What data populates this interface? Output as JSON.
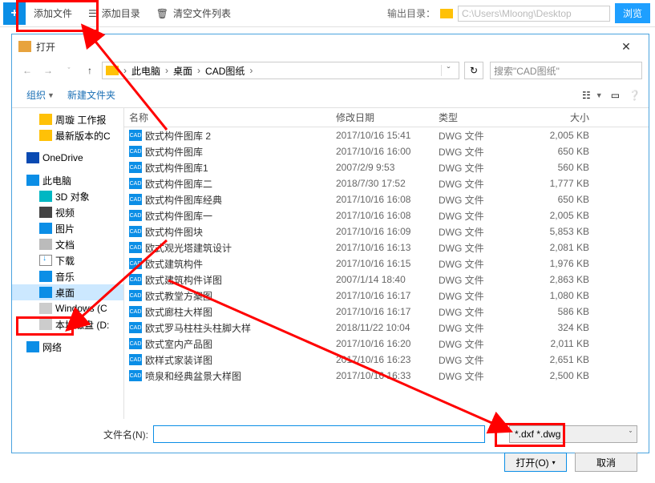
{
  "toolbar": {
    "add_file": "添加文件",
    "add_dir": "添加目录",
    "clear_list": "清空文件列表",
    "output_label": "输出目录：",
    "output_path": "C:\\Users\\Mloong\\Desktop",
    "browse": "浏览"
  },
  "dialog": {
    "title": "打开",
    "breadcrumbs": [
      "此电脑",
      "桌面",
      "CAD图纸"
    ],
    "search_placeholder": "搜索\"CAD图纸\"",
    "organize": "组织",
    "new_folder": "新建文件夹",
    "columns": {
      "name": "名称",
      "date": "修改日期",
      "type": "类型",
      "size": "大小"
    },
    "filename_label": "文件名(N):",
    "filter": "*.dxf *.dwg",
    "open_btn": "打开(O)",
    "cancel_btn": "取消"
  },
  "tree": [
    {
      "label": "周璇 工作报",
      "icon": "ico-folder",
      "sub": true
    },
    {
      "label": "最新版本的C",
      "icon": "ico-folder",
      "sub": true
    },
    {
      "sep": true
    },
    {
      "label": "OneDrive",
      "icon": "ico-onedrive"
    },
    {
      "sep": true
    },
    {
      "label": "此电脑",
      "icon": "ico-pc"
    },
    {
      "label": "3D 对象",
      "icon": "ico-3d",
      "sub": true
    },
    {
      "label": "视频",
      "icon": "ico-video",
      "sub": true
    },
    {
      "label": "图片",
      "icon": "ico-pic",
      "sub": true
    },
    {
      "label": "文档",
      "icon": "ico-doc",
      "sub": true
    },
    {
      "label": "下载",
      "icon": "ico-dl",
      "sub": true
    },
    {
      "label": "音乐",
      "icon": "ico-music",
      "sub": true
    },
    {
      "label": "桌面",
      "icon": "ico-desktop",
      "sub": true,
      "selected": true
    },
    {
      "label": "Windows (C",
      "icon": "ico-disk",
      "sub": true
    },
    {
      "label": "本地磁盘 (D:",
      "icon": "ico-disk",
      "sub": true
    },
    {
      "sep": true
    },
    {
      "label": "网络",
      "icon": "ico-net"
    }
  ],
  "files": [
    {
      "name": "欧式构件图库 2",
      "date": "2017/10/16 15:41",
      "type": "DWG 文件",
      "size": "2,005 KB"
    },
    {
      "name": "欧式构件图库",
      "date": "2017/10/16 16:00",
      "type": "DWG 文件",
      "size": "650 KB"
    },
    {
      "name": "欧式构件图库1",
      "date": "2007/2/9 9:53",
      "type": "DWG 文件",
      "size": "560 KB"
    },
    {
      "name": "欧式构件图库二",
      "date": "2018/7/30 17:52",
      "type": "DWG 文件",
      "size": "1,777 KB"
    },
    {
      "name": "欧式构件图库经典",
      "date": "2017/10/16 16:08",
      "type": "DWG 文件",
      "size": "650 KB"
    },
    {
      "name": "欧式构件图库一",
      "date": "2017/10/16 16:08",
      "type": "DWG 文件",
      "size": "2,005 KB"
    },
    {
      "name": "欧式构件图块",
      "date": "2017/10/16 16:09",
      "type": "DWG 文件",
      "size": "5,853 KB"
    },
    {
      "name": "欧式观光塔建筑设计",
      "date": "2017/10/16 16:13",
      "type": "DWG 文件",
      "size": "2,081 KB"
    },
    {
      "name": "欧式建筑构件",
      "date": "2017/10/16 16:15",
      "type": "DWG 文件",
      "size": "1,976 KB"
    },
    {
      "name": "欧式建筑构件详图",
      "date": "2007/1/14 18:40",
      "type": "DWG 文件",
      "size": "2,863 KB"
    },
    {
      "name": "欧式教堂方案图",
      "date": "2017/10/16 16:17",
      "type": "DWG 文件",
      "size": "1,080 KB"
    },
    {
      "name": "欧式廊柱大样图",
      "date": "2017/10/16 16:17",
      "type": "DWG 文件",
      "size": "586 KB"
    },
    {
      "name": "欧式罗马柱柱头柱脚大样",
      "date": "2018/11/22 10:04",
      "type": "DWG 文件",
      "size": "324 KB"
    },
    {
      "name": "欧式室内产品图",
      "date": "2017/10/16 16:20",
      "type": "DWG 文件",
      "size": "2,011 KB"
    },
    {
      "name": "欧样式家装详图",
      "date": "2017/10/16 16:23",
      "type": "DWG 文件",
      "size": "2,651 KB"
    },
    {
      "name": "喷泉和经典盆景大样图",
      "date": "2017/10/16 16:33",
      "type": "DWG 文件",
      "size": "2,500 KB"
    }
  ]
}
